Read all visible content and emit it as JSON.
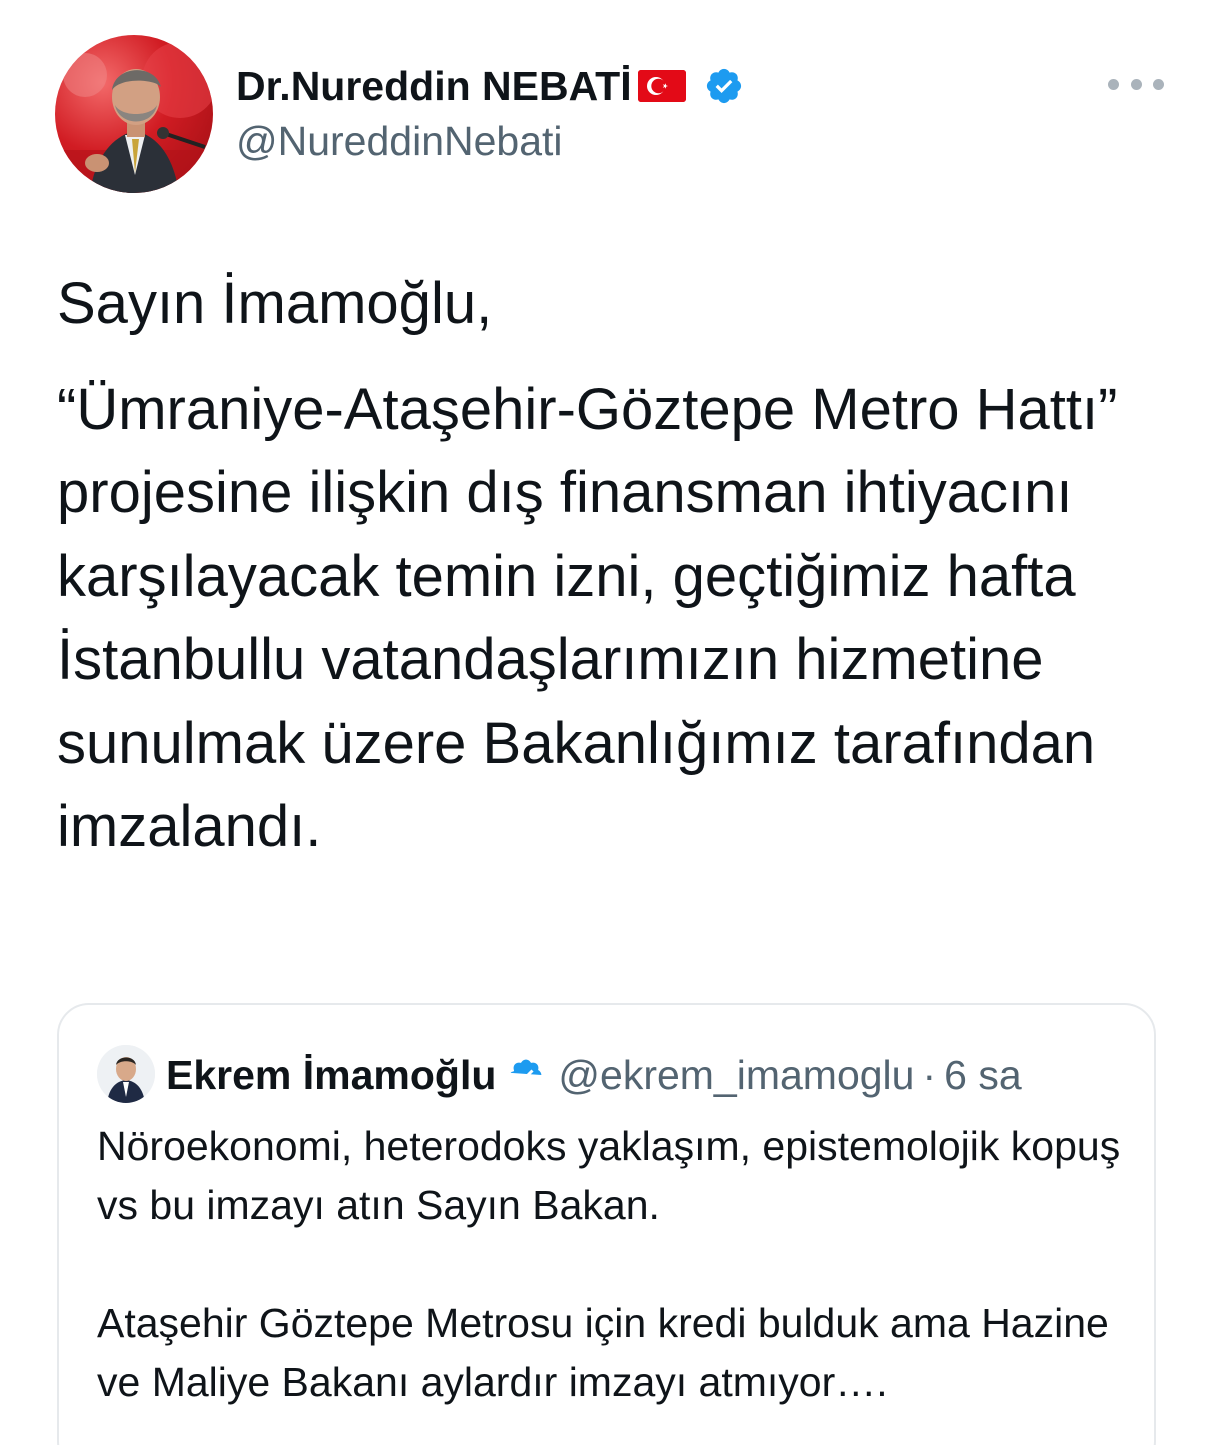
{
  "tweet": {
    "author": {
      "display_name": "Dr.Nureddin NEBATİ",
      "handle": "@NureddinNebati",
      "flag_icon": "turkey-flag-emoji",
      "verified": true
    },
    "more_icon": "more-options-icon",
    "paragraphs": [
      "Sayın İmamoğlu,",
      "“Ümraniye-Ataşehir-Göztepe Metro Hattı” projesine ilişkin dış finansman ihtiyacını karşılayacak temin izni, geçtiğimiz hafta İstanbullu vatandaşlarımızın hizmetine sunulmak üzere Bakanlığımız tarafından imzalandı."
    ]
  },
  "quoted_tweet": {
    "author": {
      "display_name": "Ekrem İmamoğlu",
      "handle": "@ekrem_imamoglu",
      "verified": true
    },
    "separator": "·",
    "time": "6 sa",
    "paragraphs": [
      "Nöroekonomi, heterodoks yaklaşım, epistemolojik kopuş vs bu imzayı atın Sayın Bakan.",
      "Ataşehir Göztepe Metrosu için kredi bulduk ama Hazine ve Maliye Bakanı aylardır imzayı atmıyor…."
    ]
  },
  "colors": {
    "text": "#0f1419",
    "secondary": "#536471",
    "verified_blue": "#1d9bf0",
    "border": "#e6e9ec",
    "flag_red": "#e30a17"
  }
}
